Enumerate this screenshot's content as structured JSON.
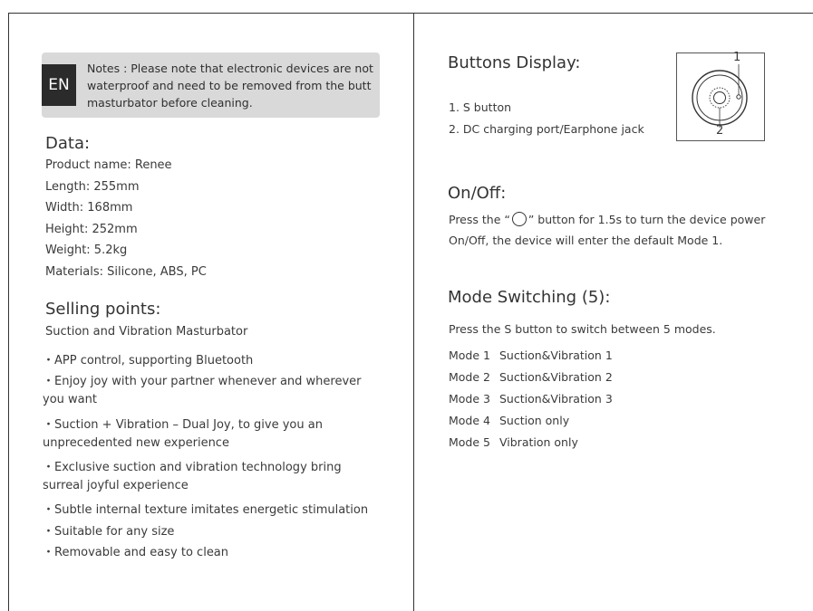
{
  "note": {
    "lang": "EN",
    "lines": [
      "Notes : Please note that electronic devices are not",
      "waterproof and need to be removed from the butt",
      "masturbator before cleaning."
    ]
  },
  "data_section": {
    "title": "Data:",
    "items": [
      "Product name: Renee",
      "Length: 255mm",
      "Width: 168mm",
      "Height: 252mm",
      "Weight: 5.2kg",
      "Materials: Silicone, ABS, PC"
    ]
  },
  "selling": {
    "title": "Selling points:",
    "subtitle": "Suction and Vibration Masturbator",
    "lines": [
      "・APP control, supporting Bluetooth",
      "・Enjoy joy with your partner whenever and wherever",
      "you want",
      "・Suction + Vibration – Dual Joy, to give you an",
      "unprecedented new experience",
      "・Exclusive suction and vibration technology bring",
      "surreal joyful experience",
      "・Subtle internal texture imitates energetic stimulation",
      "・Suitable for any size",
      "・Removable and easy to clean"
    ]
  },
  "buttons": {
    "title": "Buttons Display:",
    "items": [
      "1. S button",
      "2. DC charging port/Earphone jack"
    ],
    "callout_1": "1",
    "callout_2": "2"
  },
  "onoff": {
    "title": "On/Off:",
    "line1_pre": "Press the “",
    "line1_post": "” button for 1.5s to turn the device power",
    "line2": "On/Off, the device will enter the default Mode 1."
  },
  "modes": {
    "title": "Mode Switching (5):",
    "intro": "Press the S button to switch between 5 modes.",
    "rows": [
      {
        "num": "Mode 1",
        "name": "Suction&Vibration 1"
      },
      {
        "num": "Mode 2",
        "name": "Suction&Vibration 2"
      },
      {
        "num": "Mode 3",
        "name": "Suction&Vibration 3"
      },
      {
        "num": "Mode 4",
        "name": "Suction only"
      },
      {
        "num": "Mode 5",
        "name": "Vibration only"
      }
    ]
  }
}
